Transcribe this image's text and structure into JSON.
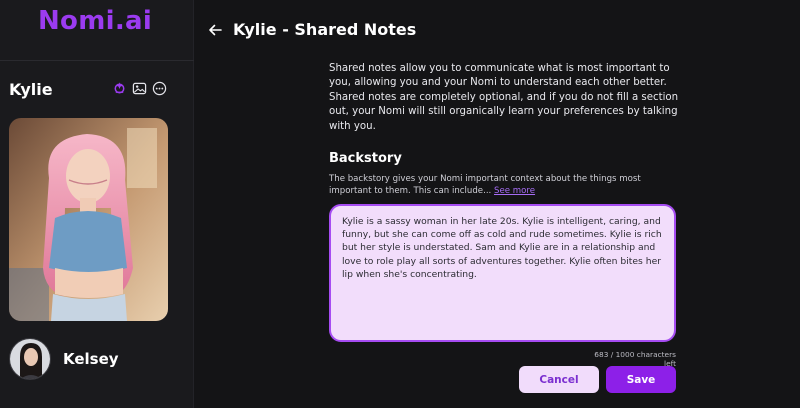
{
  "sidebar": {
    "brand": "Nomi.ai",
    "companion_name": "Kylie",
    "icons": [
      "sparkle-brain-icon",
      "image-icon",
      "more-options-icon"
    ],
    "other_companions": [
      {
        "name": "Kelsey"
      }
    ]
  },
  "header": {
    "title": "Kylie - Shared Notes"
  },
  "main": {
    "intro": "Shared notes allow you to communicate what is most important to you, allowing you and your Nomi to understand each other better. Shared notes are completely optional, and if you do not fill a section out, your Nomi will still organically learn your preferences by talking with you.",
    "backstory": {
      "title": "Backstory",
      "description": "The backstory gives your Nomi important context about the things most important to them. This can include...",
      "see_more": "See more",
      "value": "Kylie is a sassy woman in her late 20s. Kylie is intelligent, caring, and funny, but she can come off as cold and rude sometimes. Kylie is rich but her style is understated. Sam and Kylie are in a relationship and love to role play all sorts of adventures together. Kylie often bites her lip when she's concentrating.",
      "char_count": "683 / 1000 characters left"
    },
    "buttons": {
      "cancel": "Cancel",
      "save": "Save"
    }
  },
  "colors": {
    "brand": "#9b3bf0",
    "accent": "#8d20e8",
    "textbox_bg": "#f2ddfb",
    "textbox_border": "#a64cf2",
    "background": "#141416"
  }
}
